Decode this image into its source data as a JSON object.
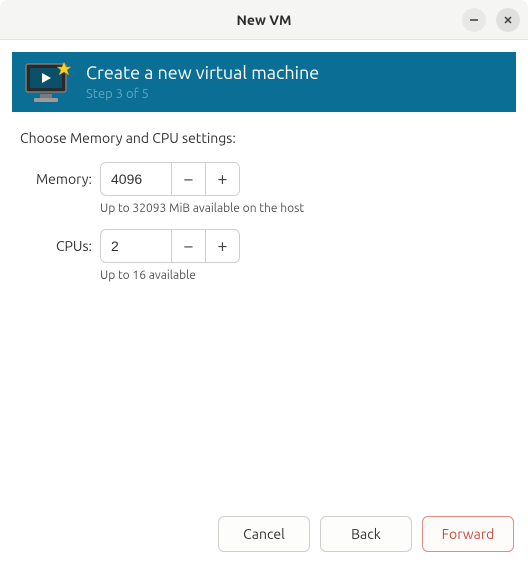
{
  "window": {
    "title": "New VM"
  },
  "banner": {
    "title": "Create a new virtual machine",
    "step": "Step 3 of 5"
  },
  "form": {
    "heading": "Choose Memory and CPU settings:",
    "memory": {
      "label": "Memory:",
      "value": "4096",
      "hint": "Up to 32093 MiB available on the host"
    },
    "cpus": {
      "label": "CPUs:",
      "value": "2",
      "hint": "Up to 16 available"
    }
  },
  "buttons": {
    "cancel": "Cancel",
    "back": "Back",
    "forward": "Forward"
  },
  "glyphs": {
    "minus": "−",
    "plus": "+"
  }
}
